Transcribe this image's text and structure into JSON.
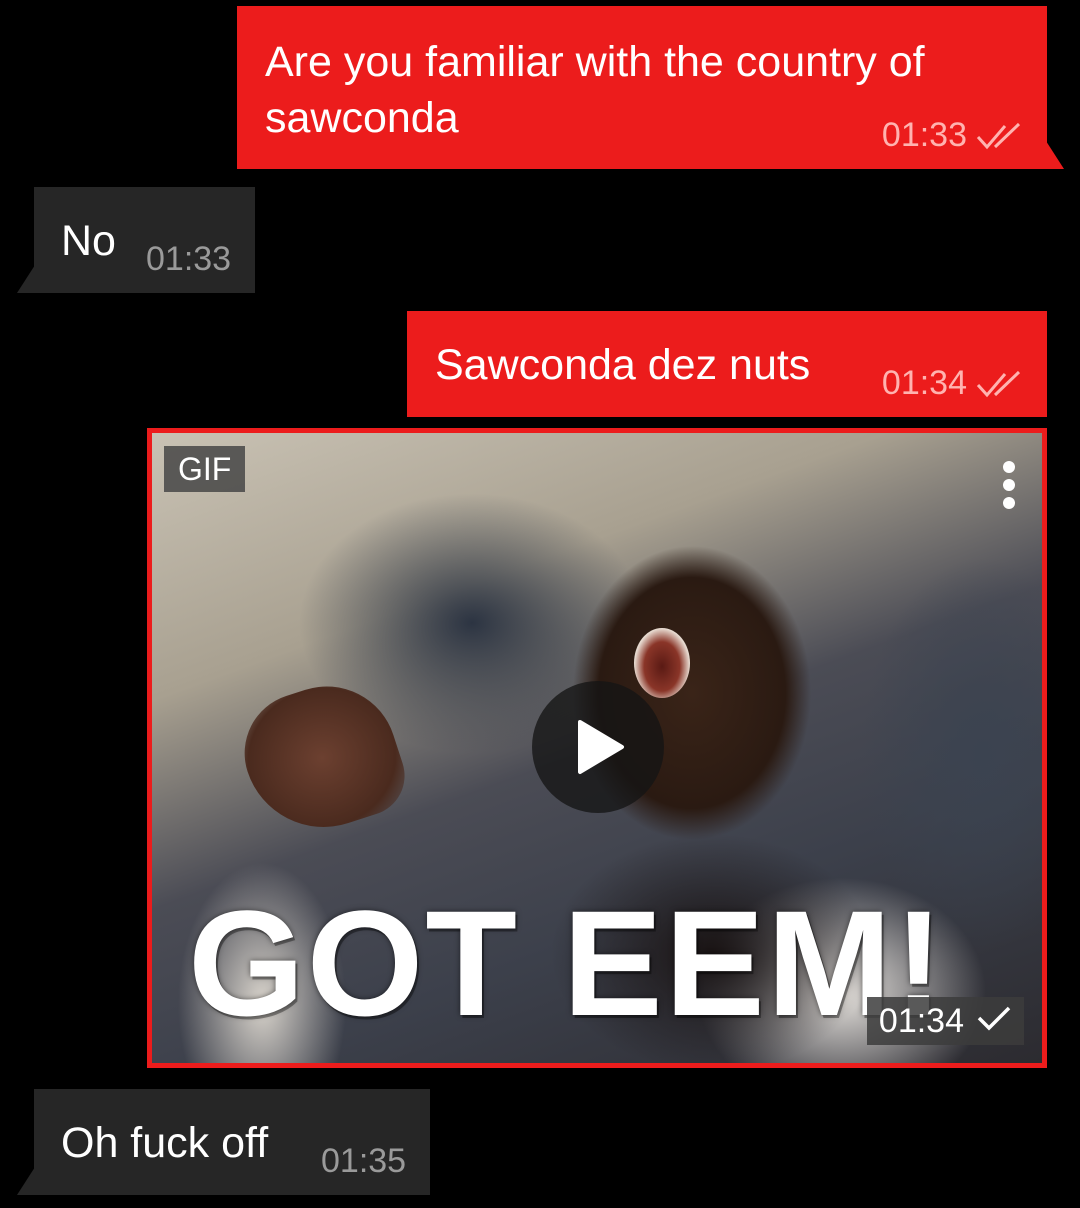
{
  "colors": {
    "background": "#000000",
    "outgoing_bubble": "#ec1c1c",
    "incoming_bubble": "#262626",
    "outgoing_meta": "#ffb3b0",
    "incoming_meta": "#9a9a9a"
  },
  "messages": [
    {
      "direction": "outgoing",
      "text": "Are you familiar with the country of\nsawconda",
      "time": "01:33",
      "status_icon": "double-check-icon"
    },
    {
      "direction": "incoming",
      "text": "No",
      "time": "01:33"
    },
    {
      "direction": "outgoing",
      "text": "Sawconda dez nuts",
      "time": "01:34",
      "status_icon": "double-check-icon"
    },
    {
      "direction": "outgoing",
      "type": "gif",
      "badge": "GIF",
      "caption": "GOT EEM!",
      "time": "01:34",
      "status_icon": "single-check-icon",
      "more_icon": "more-vertical-icon",
      "play_icon": "play-icon"
    },
    {
      "direction": "incoming",
      "text": "Oh fuck off",
      "time": "01:35"
    }
  ]
}
